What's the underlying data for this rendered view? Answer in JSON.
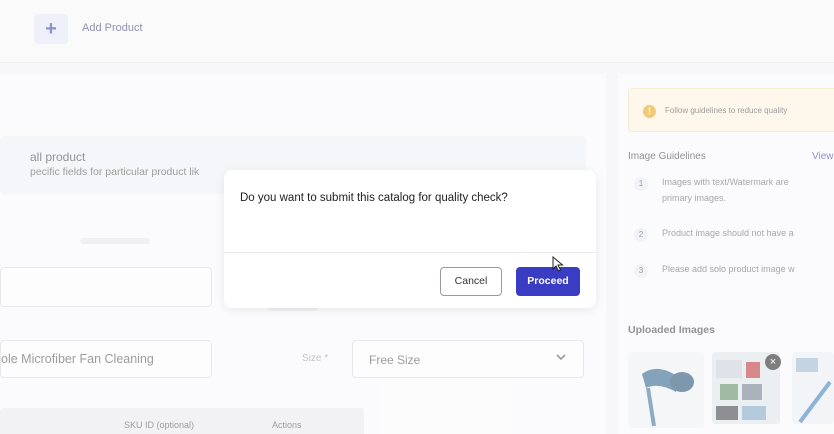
{
  "header": {
    "plus_symbol": "+",
    "add_product_label": "Add Product"
  },
  "form": {
    "hint_title": "all product",
    "hint_subtitle": "pecific fields for particular product lik",
    "product_name_value": "ole Microfiber Fan Cleaning",
    "size_label": "Size *",
    "size_value": "Free Size",
    "table_headers": {
      "sku": "SKU ID (optional)",
      "actions": "Actions"
    }
  },
  "right_panel": {
    "banner_text": "Follow guidelines to reduce quality",
    "image_guidelines_title": "Image Guidelines",
    "view_link": "View",
    "guidelines": [
      {
        "num": "1",
        "line1": "Images with text/Watermark are",
        "line2": "primary images."
      },
      {
        "num": "2",
        "line1": "Product image should not have a"
      },
      {
        "num": "3",
        "line1": "Please add solo product image w"
      }
    ],
    "uploaded_images_title": "Uploaded Images"
  },
  "dialog": {
    "question": "Do you want to submit this catalog for quality check?",
    "cancel_label": "Cancel",
    "proceed_label": "Proceed"
  },
  "colors": {
    "accent": "#3a3dc4",
    "warning": "#e8a317",
    "banner_bg": "#fbf3dc"
  }
}
